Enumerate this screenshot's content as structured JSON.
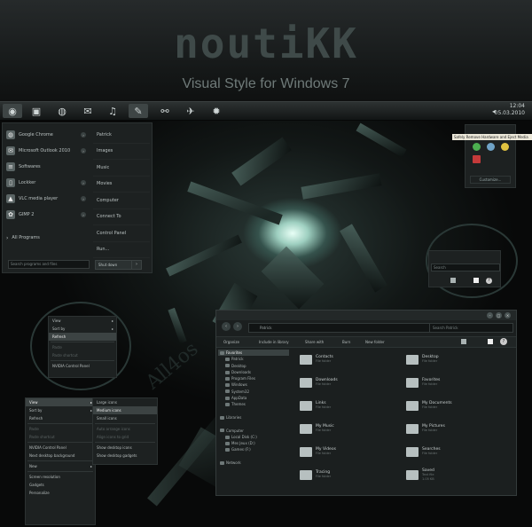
{
  "banner": {
    "logo": "noutiKK",
    "subtitle": "Visual Style for Windows 7"
  },
  "taskbar": {
    "icons": [
      "start-orb-icon",
      "folder-icon",
      "chrome-icon",
      "mail-icon",
      "music-icon",
      "feather-icon",
      "network-icon",
      "wrench-icon",
      "gear-icon"
    ],
    "clock_time": "12:04",
    "clock_date": "05.03.2010"
  },
  "start_menu": {
    "programs": [
      {
        "label": "Google Chrome"
      },
      {
        "label": "Microsoft Outlook 2010"
      },
      {
        "label": "Softwares"
      },
      {
        "label": "Lockker"
      },
      {
        "label": "VLC media player"
      },
      {
        "label": "GIMP 2"
      }
    ],
    "all_programs": "All Programs",
    "search_placeholder": "Search programs and files",
    "right_items": [
      "Patrick",
      "Images",
      "Music",
      "Movies",
      "Computer",
      "Connect To",
      "Control Panel",
      "Run..."
    ],
    "shutdown": "Shut down"
  },
  "tray": {
    "tooltip": "Safely Remove Hardware and Eject Media",
    "customize": "Customize..."
  },
  "context_small": {
    "items": [
      {
        "label": "View",
        "sub": true,
        "state": "normal"
      },
      {
        "label": "Sort by",
        "sub": true,
        "state": "normal"
      },
      {
        "label": "Refresh",
        "sub": false,
        "state": "selected"
      },
      {
        "label": "Paste",
        "sub": false,
        "state": "disabled"
      },
      {
        "label": "Paste shortcut",
        "sub": false,
        "state": "disabled"
      },
      {
        "label": "NVIDIA Control Panel",
        "sub": false,
        "state": "normal"
      }
    ]
  },
  "context_big": {
    "items": [
      {
        "label": "View",
        "sub": true,
        "state": "selected"
      },
      {
        "label": "Sort by",
        "sub": true,
        "state": "normal"
      },
      {
        "label": "Refresh",
        "sub": false,
        "state": "normal"
      },
      {
        "label": "Paste",
        "sub": false,
        "state": "disabled"
      },
      {
        "label": "Paste shortcut",
        "sub": false,
        "state": "disabled"
      },
      {
        "label": "NVIDIA Control Panel",
        "sub": false,
        "state": "normal"
      },
      {
        "label": "Next desktop background",
        "sub": false,
        "state": "normal"
      },
      {
        "label": "New",
        "sub": true,
        "state": "normal"
      },
      {
        "label": "Screen resolution",
        "sub": false,
        "state": "normal"
      },
      {
        "label": "Gadgets",
        "sub": false,
        "state": "normal"
      },
      {
        "label": "Personalize",
        "sub": false,
        "state": "normal"
      }
    ],
    "submenu": [
      {
        "label": "Large icons",
        "state": "normal"
      },
      {
        "label": "Medium icons",
        "state": "selected"
      },
      {
        "label": "Small icons",
        "state": "normal"
      },
      {
        "label": "Auto arrange icons",
        "state": "disabled"
      },
      {
        "label": "Align icons to grid",
        "state": "disabled"
      },
      {
        "label": "Show desktop icons",
        "state": "normal"
      },
      {
        "label": "Show desktop gadgets",
        "state": "normal"
      }
    ]
  },
  "explorer": {
    "address": "Patrick",
    "search_placeholder": "Search Patrick",
    "toolbar": [
      "Organize",
      "Include in library",
      "Share with",
      "Burn",
      "New folder"
    ],
    "nav": [
      {
        "label": "Favorites",
        "sel": true
      },
      {
        "label": "Patrick",
        "sel": false
      },
      {
        "label": "Desktop",
        "sel": false
      },
      {
        "label": "Downloads",
        "sel": false
      },
      {
        "label": "Program Files",
        "sel": false
      },
      {
        "label": "Windows",
        "sel": false
      },
      {
        "label": "System32",
        "sel": false
      },
      {
        "label": "AppData",
        "sel": false
      },
      {
        "label": "Themes",
        "sel": false
      },
      {
        "label": "",
        "sel": false
      },
      {
        "label": "Libraries",
        "sel": false
      },
      {
        "label": "",
        "sel": false
      },
      {
        "label": "Computer",
        "sel": false
      },
      {
        "label": "Local Disk (C:)",
        "sel": false
      },
      {
        "label": "Mes Jeux (D:)",
        "sel": false
      },
      {
        "label": "Games (F:)",
        "sel": false
      },
      {
        "label": "",
        "sel": false
      },
      {
        "label": "Network",
        "sel": false
      }
    ],
    "items": [
      {
        "name": "Contacts",
        "type": "File folder",
        "icon": "contacts-icon"
      },
      {
        "name": "Desktop",
        "type": "File folder",
        "icon": "desktop-icon"
      },
      {
        "name": "Downloads",
        "type": "File folder",
        "icon": "downloads-icon"
      },
      {
        "name": "Favorites",
        "type": "File folder",
        "icon": "star-icon"
      },
      {
        "name": "Links",
        "type": "File folder",
        "icon": "links-icon"
      },
      {
        "name": "My Documents",
        "type": "File folder",
        "icon": "documents-icon"
      },
      {
        "name": "My Music",
        "type": "File folder",
        "icon": "music-icon"
      },
      {
        "name": "My Pictures",
        "type": "File folder",
        "icon": "pictures-icon"
      },
      {
        "name": "My Videos",
        "type": "File folder",
        "icon": "videos-icon"
      },
      {
        "name": "Searches",
        "type": "File folder",
        "icon": "search-icon"
      },
      {
        "name": "Tracing",
        "type": "File folder",
        "icon": "folder-icon"
      },
      {
        "name": "Saved",
        "type": "Text file",
        "size": "1.05 KB",
        "icon": "file-icon"
      }
    ]
  },
  "zoom_explorer": {
    "search_placeholder": "Search"
  },
  "watermark": "All4os"
}
